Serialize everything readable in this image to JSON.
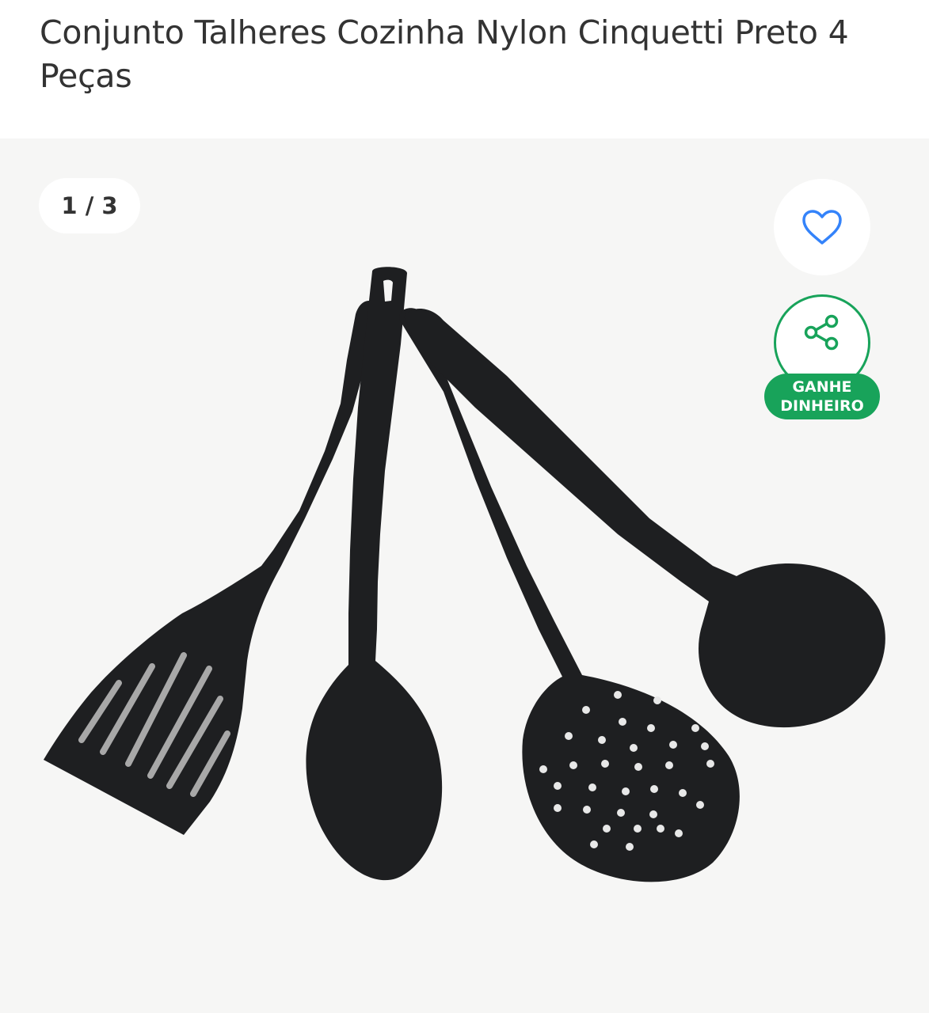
{
  "product": {
    "title": "Conjunto Talheres Cozinha Nylon Cinquetti Preto 4 Peças"
  },
  "gallery": {
    "counter": "1 / 3",
    "favorite_icon": "heart-icon",
    "share_icon": "share-icon",
    "share_badge_line1": "GANHE",
    "share_badge_line2": "DINHEIRO",
    "colors": {
      "background": "#f6f6f5",
      "heart": "#3483fa",
      "green": "#18a35a",
      "utensil": "#1e1f21"
    }
  }
}
